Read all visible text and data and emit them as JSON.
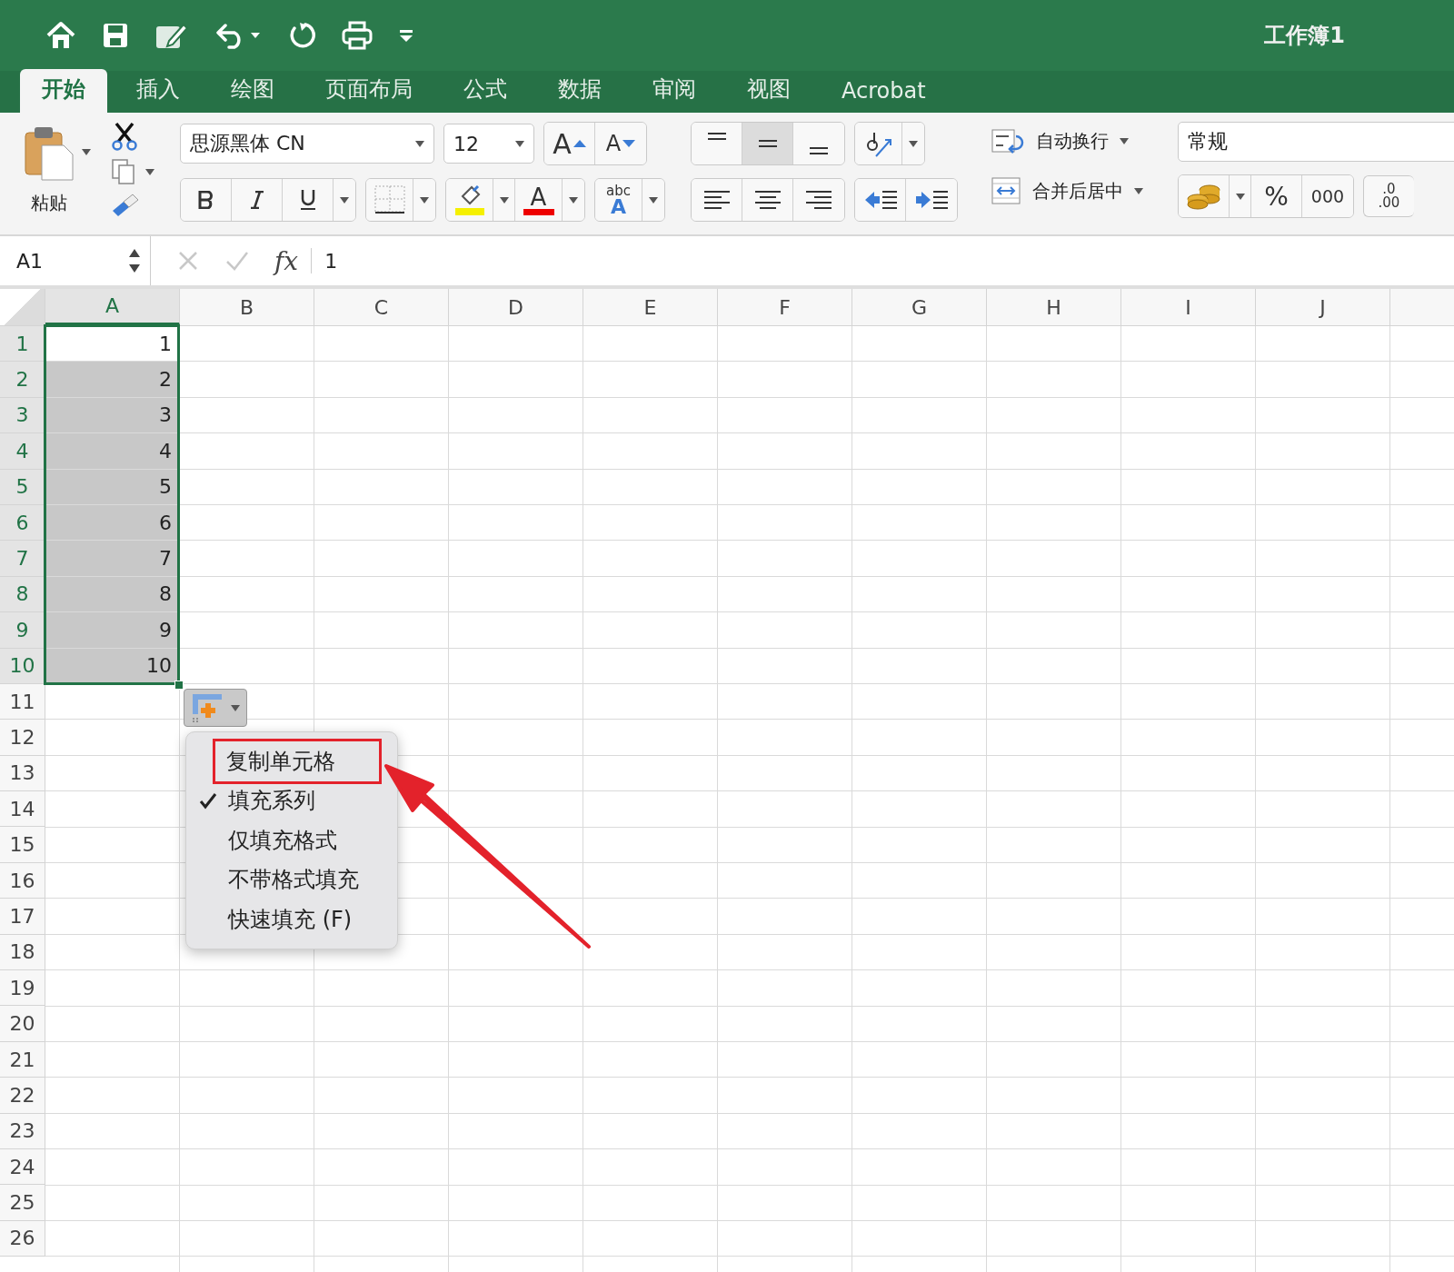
{
  "window": {
    "title": "工作簿1"
  },
  "tabs": [
    {
      "label": "开始",
      "selected": true
    },
    {
      "label": "插入",
      "selected": false
    },
    {
      "label": "绘图",
      "selected": false
    },
    {
      "label": "页面布局",
      "selected": false
    },
    {
      "label": "公式",
      "selected": false
    },
    {
      "label": "数据",
      "selected": false
    },
    {
      "label": "审阅",
      "selected": false
    },
    {
      "label": "视图",
      "selected": false
    },
    {
      "label": "Acrobat",
      "selected": false
    }
  ],
  "ribbon": {
    "paste_label": "粘贴",
    "font": {
      "value": "思源黑体 CN"
    },
    "size": {
      "value": "12"
    },
    "grow_font": "A",
    "shrink_font": "A",
    "font_color_letter": "A",
    "text_effect": {
      "top": "abc",
      "bottom": "A"
    },
    "vertical_align": [
      {
        "selected": false
      },
      {
        "selected": true
      },
      {
        "selected": false
      }
    ],
    "wrap_text": "自动换行",
    "merge_center": "合并后居中",
    "number_format": {
      "value": "常规"
    },
    "percent": "%",
    "thousands": "000",
    "decimal": {
      "top": ".0",
      "bottom": ".00"
    }
  },
  "formula_bar": {
    "name_box": "A1",
    "fx": "fx",
    "formula": "1"
  },
  "sheet": {
    "columns": [
      {
        "label": "A",
        "selected": true
      },
      {
        "label": "B",
        "selected": false
      },
      {
        "label": "C",
        "selected": false
      },
      {
        "label": "D",
        "selected": false
      },
      {
        "label": "E",
        "selected": false
      },
      {
        "label": "F",
        "selected": false
      },
      {
        "label": "G",
        "selected": false
      },
      {
        "label": "H",
        "selected": false
      },
      {
        "label": "I",
        "selected": false
      },
      {
        "label": "J",
        "selected": false
      }
    ],
    "rows": [
      {
        "label": "1",
        "selected": true,
        "cell_a": {
          "value": "1",
          "highlighted": false
        }
      },
      {
        "label": "2",
        "selected": true,
        "cell_a": {
          "value": "2",
          "highlighted": true
        }
      },
      {
        "label": "3",
        "selected": true,
        "cell_a": {
          "value": "3",
          "highlighted": true
        }
      },
      {
        "label": "4",
        "selected": true,
        "cell_a": {
          "value": "4",
          "highlighted": true
        }
      },
      {
        "label": "5",
        "selected": true,
        "cell_a": {
          "value": "5",
          "highlighted": true
        }
      },
      {
        "label": "6",
        "selected": true,
        "cell_a": {
          "value": "6",
          "highlighted": true
        }
      },
      {
        "label": "7",
        "selected": true,
        "cell_a": {
          "value": "7",
          "highlighted": true
        }
      },
      {
        "label": "8",
        "selected": true,
        "cell_a": {
          "value": "8",
          "highlighted": true
        }
      },
      {
        "label": "9",
        "selected": true,
        "cell_a": {
          "value": "9",
          "highlighted": true
        }
      },
      {
        "label": "10",
        "selected": true,
        "cell_a": {
          "value": "10",
          "highlighted": true
        }
      },
      {
        "label": "11",
        "selected": false
      },
      {
        "label": "12",
        "selected": false
      },
      {
        "label": "13",
        "selected": false
      },
      {
        "label": "14",
        "selected": false
      },
      {
        "label": "15",
        "selected": false
      },
      {
        "label": "16",
        "selected": false
      },
      {
        "label": "17",
        "selected": false
      },
      {
        "label": "18",
        "selected": false
      },
      {
        "label": "19",
        "selected": false
      },
      {
        "label": "20",
        "selected": false
      },
      {
        "label": "21",
        "selected": false
      },
      {
        "label": "22",
        "selected": false
      },
      {
        "label": "23",
        "selected": false
      },
      {
        "label": "24",
        "selected": false
      },
      {
        "label": "25",
        "selected": false
      },
      {
        "label": "26",
        "selected": false
      }
    ]
  },
  "fill_options_menu": [
    {
      "label": "复制单元格",
      "checked": false,
      "highlighted": true
    },
    {
      "label": "填充系列",
      "checked": true,
      "highlighted": false
    },
    {
      "label": "仅填充格式",
      "checked": false,
      "highlighted": false
    },
    {
      "label": "不带格式填充",
      "checked": false,
      "highlighted": false
    },
    {
      "label": "快速填充 (F)",
      "checked": false,
      "highlighted": false
    }
  ]
}
